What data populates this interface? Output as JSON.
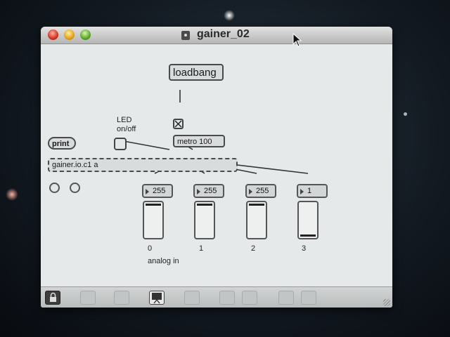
{
  "window": {
    "title": "gainer_02",
    "title_icon": "patcher-document-icon"
  },
  "patch": {
    "loadbang": "loadbang",
    "metro": "metro 100",
    "print": "print",
    "gainer": "gainer.io.c1 a",
    "led_label_line1": "LED",
    "led_label_line2": "on/off",
    "analog_in_label": "analog in",
    "channels": [
      {
        "index": "0",
        "value": "255",
        "level": 1.0
      },
      {
        "index": "1",
        "value": "255",
        "level": 1.0
      },
      {
        "index": "2",
        "value": "255",
        "level": 1.0
      },
      {
        "index": "3",
        "value": "1",
        "level": 0.0
      }
    ]
  },
  "toolbar": {
    "icons": [
      "lock-icon",
      "new-object-icon",
      "move-icon",
      "presentation-icon",
      "info-icon",
      "copy-icon",
      "paste-icon",
      "grid-icon",
      "snap-grid-icon"
    ]
  },
  "colors": {
    "desktop_bg": "#131a22",
    "canvas_bg": "#e6e9ea",
    "patch_cord": "#333333"
  }
}
